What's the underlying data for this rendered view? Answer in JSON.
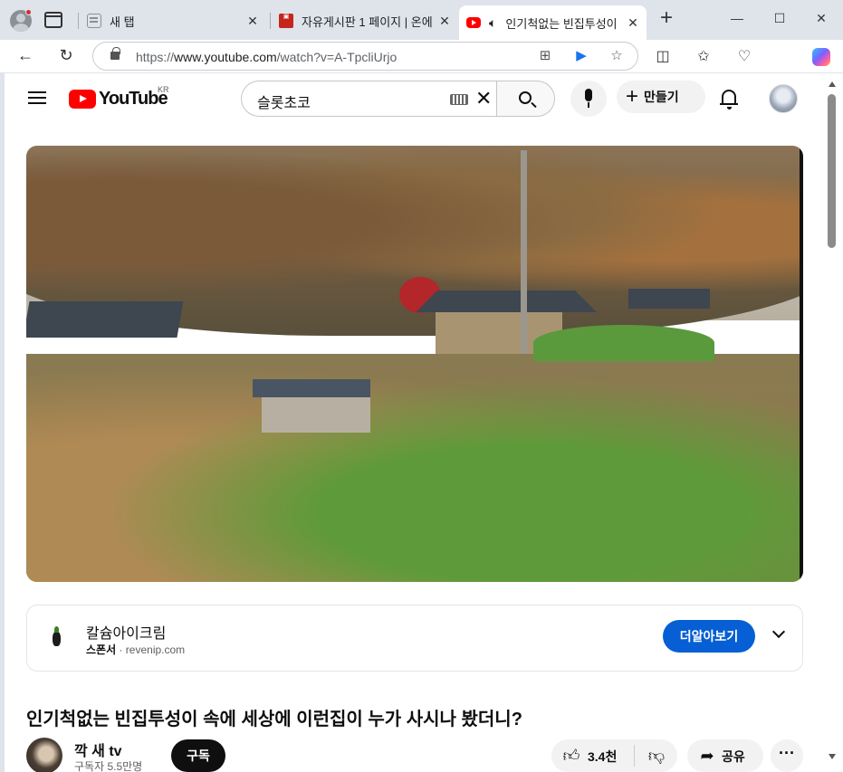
{
  "browser": {
    "tabs": [
      {
        "title": "새 탭",
        "favicon": "new-tab-favicon",
        "active": false
      },
      {
        "title": "자유게시판 1 페이지 | 온에",
        "favicon": "board-favicon",
        "active": false
      },
      {
        "title": "인기척없는 빈집투성이",
        "favicon": "youtube-favicon",
        "active": true,
        "audio": true
      }
    ],
    "url_prefix": "https://",
    "url_host": "www.youtube.com",
    "url_path": "/watch?v=A-TpcliUrjo"
  },
  "header": {
    "logo_text": "YouTube",
    "country_code": "KR",
    "search_value": "슬롯초코",
    "create_label": "만들기"
  },
  "ad": {
    "title": "칼슘아이크림",
    "sponsor_label": "스폰서",
    "separator": " · ",
    "domain": "revenip.com",
    "cta_label": "더알아보기"
  },
  "video": {
    "title": "인기척없는 빈집투성이 속에 세상에 이런집이 누가 사시나 봤더니?",
    "channel_name": "깍 새 tv",
    "subscriber_text": "구독자 5.5만명",
    "subscribe_label": "구독",
    "like_count": "3.4천",
    "share_label": "공유"
  },
  "colors": {
    "accent_blue": "#065fd4",
    "youtube_red": "#ff0000"
  }
}
